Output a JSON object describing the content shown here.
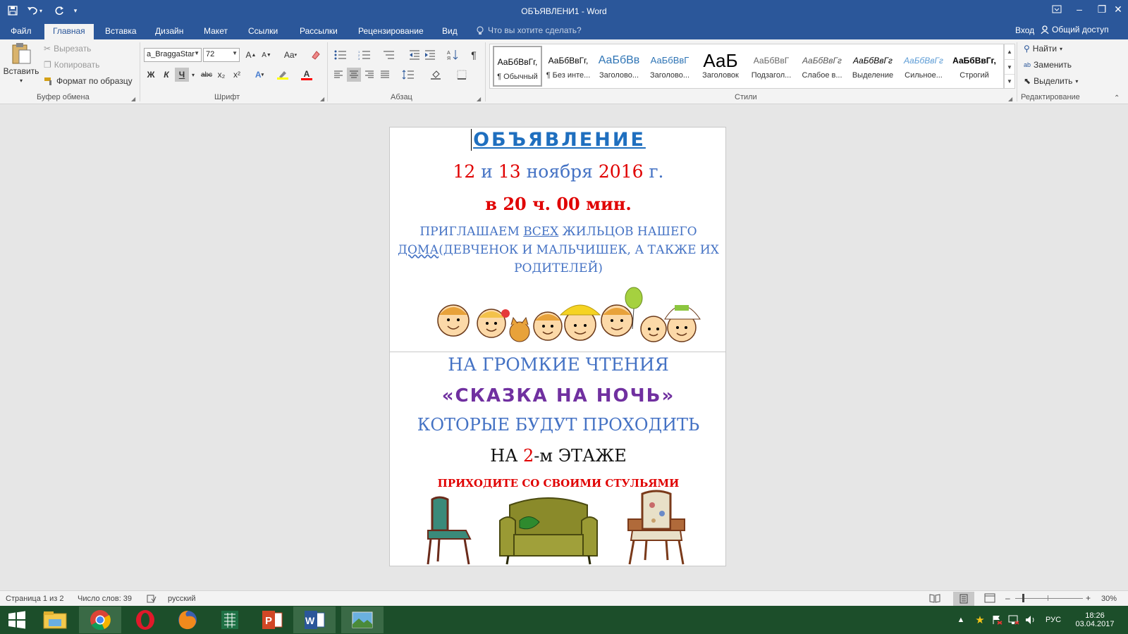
{
  "window": {
    "title": "ОБЪЯВЛЕНИ1 - Word",
    "controls": {
      "ribbon_display": "ribbon-display-icon",
      "minimize": "–",
      "restore": "❐",
      "close": "✕"
    }
  },
  "quick_access": {
    "save": "save-icon",
    "undo": "undo-icon",
    "redo": "redo-icon",
    "customize": "▾"
  },
  "tabs": [
    {
      "label": "Файл"
    },
    {
      "label": "Главная"
    },
    {
      "label": "Вставка"
    },
    {
      "label": "Дизайн"
    },
    {
      "label": "Макет"
    },
    {
      "label": "Ссылки"
    },
    {
      "label": "Рассылки"
    },
    {
      "label": "Рецензирование"
    },
    {
      "label": "Вид"
    }
  ],
  "tell_me": {
    "placeholder": "Что вы хотите сделать?"
  },
  "account": {
    "sign_in": "Вход",
    "share": "Общий доступ"
  },
  "clipboard": {
    "paste": "Вставить",
    "cut": "Вырезать",
    "copy": "Копировать",
    "format_painter": "Формат по образцу",
    "label": "Буфер обмена"
  },
  "font": {
    "name": "a_BraggaStar",
    "size": "72",
    "label": "Шрифт",
    "bold": "Ж",
    "italic": "К",
    "underline": "Ч",
    "strike": "abc",
    "subscript": "x₂",
    "superscript": "x²",
    "case": "Aa",
    "highlight_color": "#ffff00",
    "font_color": "#ff0000"
  },
  "paragraph": {
    "label": "Абзац"
  },
  "styles": {
    "label": "Стили",
    "items": [
      {
        "preview": "АаБбВвГг,",
        "name": "¶ Обычный"
      },
      {
        "preview": "АаБбВвГг,",
        "name": "¶ Без инте..."
      },
      {
        "preview": "АаБбВв",
        "name": "Заголово..."
      },
      {
        "preview": "АаБбВвГ",
        "name": "Заголово..."
      },
      {
        "preview": "АаБ",
        "name": "Заголовок"
      },
      {
        "preview": "АаБбВвГ",
        "name": "Подзагол..."
      },
      {
        "preview": "АаБбВвГг",
        "name": "Слабое в..."
      },
      {
        "preview": "АаБбВвГг",
        "name": "Выделение"
      },
      {
        "preview": "АаБбВвГг",
        "name": "Сильное..."
      },
      {
        "preview": "АаБбВвГг,",
        "name": "Строгий"
      }
    ]
  },
  "editing": {
    "find": "Найти",
    "replace": "Заменить",
    "select": "Выделить",
    "label": "Редактирование"
  },
  "document": {
    "line1": "ОБЪЯВЛЕНИЕ",
    "date": {
      "d1": "12",
      "and": " и ",
      "d2": "13",
      "month": " ноября ",
      "year": "2016",
      "g": " г."
    },
    "time": {
      "pre": "в ",
      "h": "20",
      "mid": " ч. ",
      "m": "00",
      "post": " мин."
    },
    "invite1": {
      "a": "ПРИГЛАШАЕМ ",
      "b": "ВСЕХ",
      "c": " ЖИЛЬЦОВ НАШЕГО"
    },
    "invite2": {
      "a": "ДОМА",
      "b": "(ДЕВЧЕНОК И МАЛЬЧИШЕК, А ТАКЖЕ ИХ"
    },
    "invite3": "РОДИТЕЛЕЙ)",
    "readings": "НА ГРОМКИЕ ЧТЕНИЯ",
    "event_name": "«СКАЗКА НА НОЧЬ»",
    "will_be": "КОТОРЫЕ БУДУТ ПРОХОДИТЬ",
    "floor": {
      "a": "НА ",
      "b": "2",
      "c": "-м ЭТАЖЕ"
    },
    "chairs": "ПРИХОДИТЕ СО СВОИМИ СТУЛЬЯМИ",
    "colors": {
      "blue": "#4472c4",
      "red": "#e00000",
      "purple": "#7030a0",
      "dark_blue": "#1f6fbf"
    }
  },
  "status": {
    "page": "Страница 1 из 2",
    "words": "Число слов: 39",
    "lang": "русский",
    "zoom": "30%",
    "zoom_level": 30
  },
  "taskbar": {
    "apps": [
      "explorer-icon",
      "chrome-icon",
      "opera-icon",
      "firefox-icon",
      "excel-icon",
      "powerpoint-icon",
      "word-icon",
      "photos-icon"
    ],
    "lang": "РУС",
    "time": "18:26",
    "date": "03.04.2017"
  }
}
